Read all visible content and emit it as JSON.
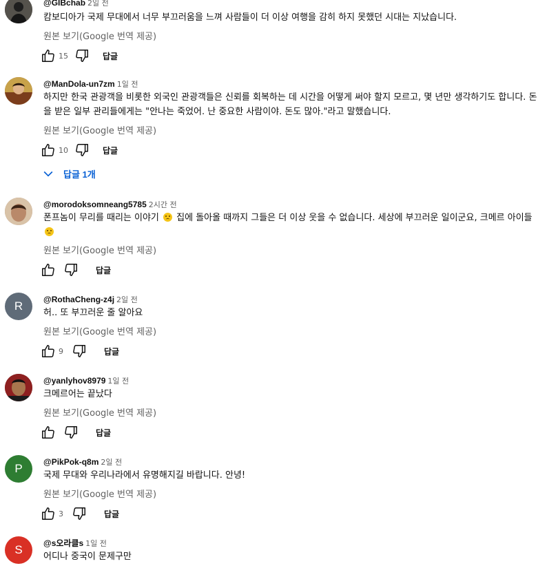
{
  "colors": {
    "link": "#065fd4",
    "secondary_text": "#606060",
    "avatar_rotha": "#5f6b78",
    "avatar_pikpok": "#2e7d32",
    "avatar_s": "#d93025"
  },
  "icons": {
    "like": "thumb-up-icon",
    "dislike": "thumb-down-icon",
    "replies": "chevron-down-icon",
    "emoji": "sad-face-emoji"
  },
  "comments": [
    {
      "author": "@GIBchab",
      "time": "2일 전",
      "text": "캄보디아가 국제 무대에서 너무 부끄러움을 느껴 사람들이 더 이상 여행을 감히 하지 못했던 시대는 지났습니다.",
      "translate": "원본 보기(Google 번역 제공)",
      "likes": "15",
      "reply": "답글"
    },
    {
      "author": "@ManDola-un7zm",
      "time": "1일 전",
      "text": "하지만 한국 관광객을 비롯한 외국인 관광객들은 신뢰를 회복하는 데 시간을 어떻게 써야 할지 모르고, 몇 년만 생각하기도 합니다. 돈을 받은 일부 관리들에게는 \"안나는 죽었어. 난 중요한 사람이야. 돈도 많아.\"라고 말했습니다.",
      "translate": "원본 보기(Google 번역 제공)",
      "likes": "10",
      "reply": "답글",
      "replies_label": "답글 1개"
    },
    {
      "author": "@morodoksomneang5785",
      "time": "2시간 전",
      "text_part1": "폰프놈이 무리를 때리는 이야기",
      "text_part2": "집에 돌아올 때까지 그들은 더 이상 웃을 수 없습니다. 세상에 부끄러운 일이군요, 크메르 아이들",
      "translate": "원본 보기(Google 번역 제공)",
      "likes": "",
      "reply": "답글"
    },
    {
      "author": "@RothaCheng-z4j",
      "time": "2일 전",
      "avatar_letter": "R",
      "text": "허.. 또 부끄러운 줄 알아요",
      "translate": "원본 보기(Google 번역 제공)",
      "likes": "9",
      "reply": "답글"
    },
    {
      "author": "@yanlyhov8979",
      "time": "1일 전",
      "text": "크메르어는 끝났다",
      "translate": "원본 보기(Google 번역 제공)",
      "likes": "",
      "reply": "답글"
    },
    {
      "author": "@PikPok-q8m",
      "time": "2일 전",
      "avatar_letter": "P",
      "text": "국제 무대와 우리나라에서 유명해지길 바랍니다. 안녕!",
      "translate": "원본 보기(Google 번역 제공)",
      "likes": "3",
      "reply": "답글"
    },
    {
      "author": "@s오라클s",
      "time": "1일 전",
      "avatar_letter": "S",
      "text": "어디나 중국이 문제구만"
    }
  ]
}
